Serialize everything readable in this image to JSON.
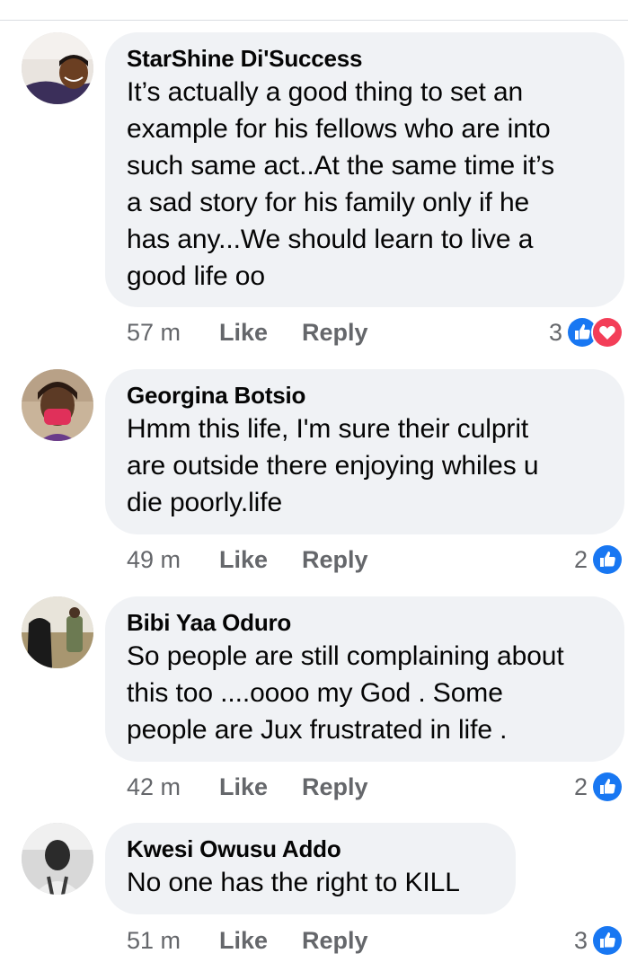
{
  "comments": [
    {
      "author": "StarShine Di'Success",
      "text": "It’s actually a good thing to set an\nexample for his fellows who are into\nsuch same act..At the same time it’s\na sad story for his family only if he\nhas any...We should learn to live a\ngood life oo",
      "time": "57 m",
      "like_label": "Like",
      "reply_label": "Reply",
      "reaction_count": "3",
      "reactions": [
        "like-icon",
        "love-icon"
      ]
    },
    {
      "author": "Georgina Botsio",
      "text": "Hmm this life, I'm sure their culprit\nare outside there enjoying whiles u\ndie poorly.life",
      "time": "49 m",
      "like_label": "Like",
      "reply_label": "Reply",
      "reaction_count": "2",
      "reactions": [
        "like-icon"
      ]
    },
    {
      "author": "Bibi Yaa Oduro",
      "text": "So people are still complaining about\nthis too ....oooo my God . Some\npeople are Jux frustrated in life .",
      "time": "42 m",
      "like_label": "Like",
      "reply_label": "Reply",
      "reaction_count": "2",
      "reactions": [
        "like-icon"
      ]
    },
    {
      "author": "Kwesi Owusu Addo",
      "text": "No one has the right to KILL",
      "time": "51 m",
      "like_label": "Like",
      "reply_label": "Reply",
      "reaction_count": "3",
      "reactions": [
        "like-icon"
      ]
    }
  ],
  "colors": {
    "bubble": "#f0f2f5",
    "meta_text": "#65676b",
    "like_blue": "#1877f2",
    "love_red": "#f33e58"
  }
}
